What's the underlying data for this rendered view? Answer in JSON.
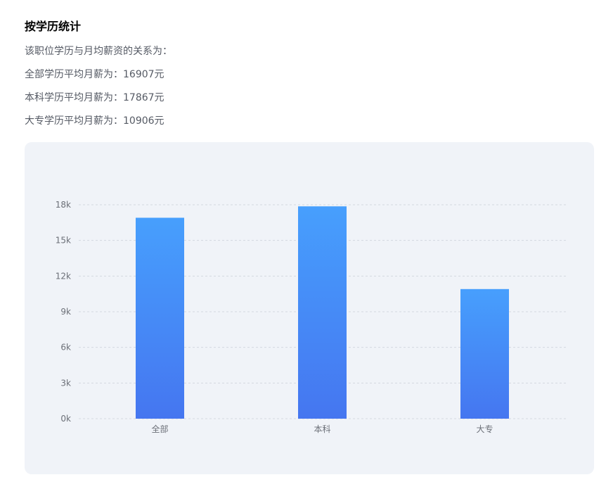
{
  "header": {
    "title": "按学历统计",
    "lines": [
      "该职位学历与月均薪资的关系为：",
      "全部学历平均月薪为：16907元",
      "本科学历平均月薪为：17867元",
      "大专学历平均月薪为：10906元"
    ]
  },
  "colors": {
    "bar_top": "#479ffd",
    "bar_bottom": "#4576f0",
    "grid": "#d3d8e0",
    "panel_bg": "#f0f3f8"
  },
  "chart_data": {
    "type": "bar",
    "categories": [
      "全部",
      "本科",
      "大专"
    ],
    "values": [
      16907,
      17867,
      10906
    ],
    "ylim": [
      0,
      18000
    ],
    "yticks": [
      0,
      3000,
      6000,
      9000,
      12000,
      15000,
      18000
    ],
    "ytick_labels": [
      "0k",
      "3k",
      "6k",
      "9k",
      "12k",
      "15k",
      "18k"
    ],
    "grid": true,
    "legend": "none"
  }
}
